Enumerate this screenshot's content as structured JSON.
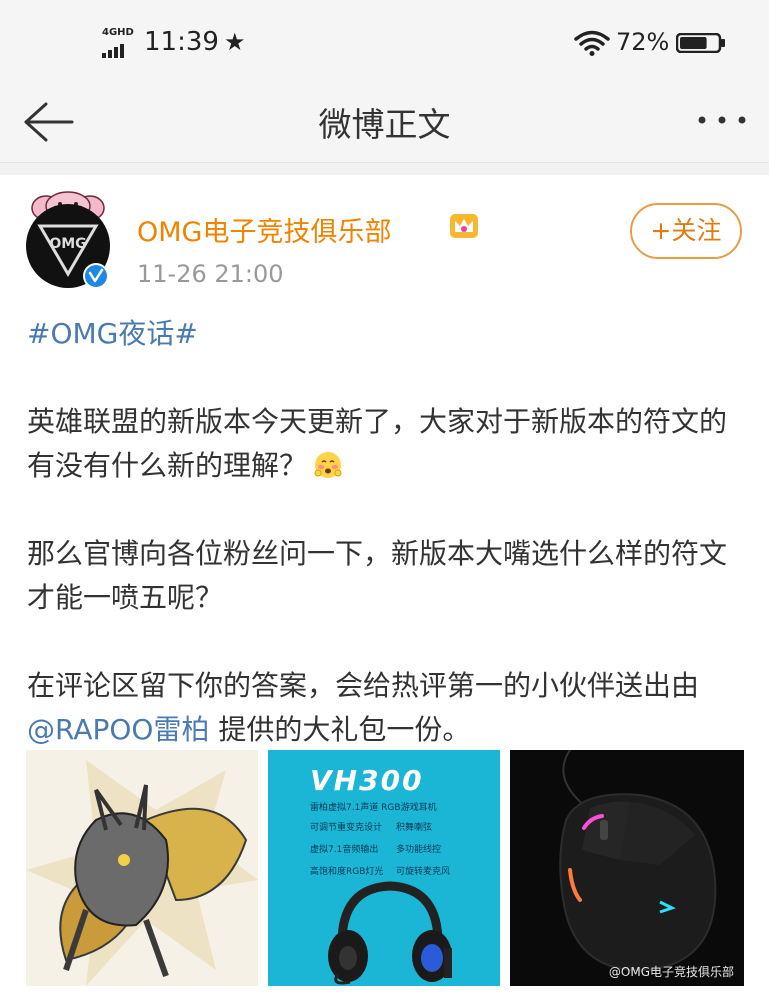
{
  "status_bar": {
    "network": "4GHD",
    "time": "11:39",
    "battery": "72%",
    "battery_level": 0.72
  },
  "nav": {
    "title": "微博正文"
  },
  "post": {
    "username": "OMG电子竞技俱乐部",
    "time": "11-26 21:00",
    "follow_label": "+关注",
    "hashtag": "#OMG夜话#",
    "paragraph1": "英雄联盟的新版本今天更新了，大家对于新版本的符文的有没有什么新的理解？",
    "paragraph2": "那么官博向各位粉丝问一下，新版本大嘴选什么样的符文才能一喷五呢？",
    "paragraph3_before": "在评论区留下你的答案，会给热评第一的小伙伴送出由",
    "mention": "@RAPOO雷柏",
    "paragraph3_after": " 提供的大礼包一份。"
  },
  "images": {
    "headset_title": "VH300",
    "headset_subtitle": "雷柏虚拟7.1声道 RGB游戏耳机",
    "headset_features": [
      "可调节重变克设计",
      "积舞喇弦",
      "虚拟7.1音频输出",
      "多功能线控",
      "高饱和度RGB灯光",
      "可旋转麦克风"
    ],
    "watermark": "@OMG电子竞技俱乐部"
  },
  "colors": {
    "accent_orange": "#f08300",
    "link_blue": "#4a7ab0",
    "follow_border": "#e89d45"
  }
}
